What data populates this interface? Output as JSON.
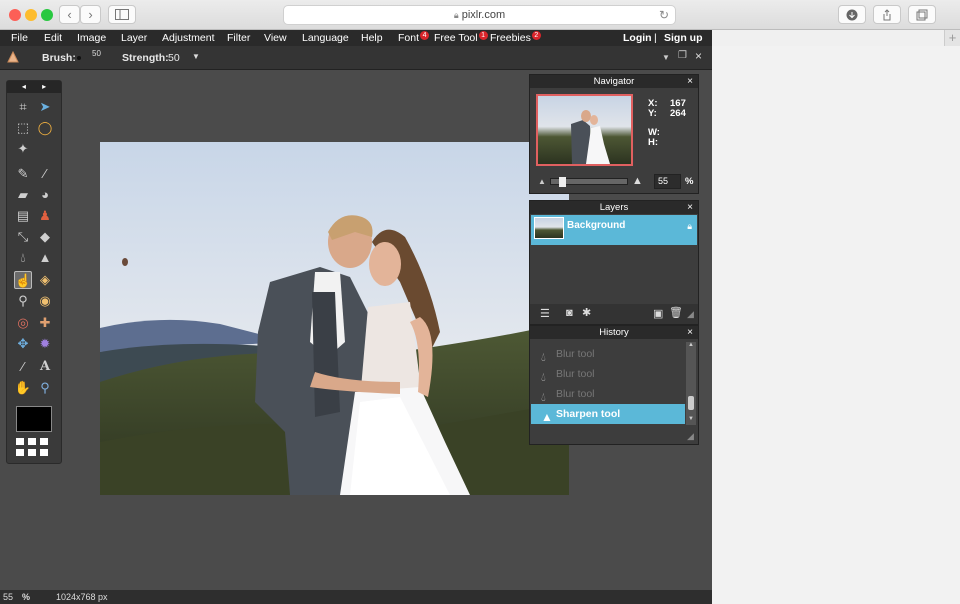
{
  "browser": {
    "url": "pixlr.com",
    "back": "‹",
    "forward": "›",
    "reload": "↻",
    "new_tab": "+"
  },
  "menu": {
    "file": "File",
    "edit": "Edit",
    "image": "Image",
    "layer": "Layer",
    "adjustment": "Adjustment",
    "filter": "Filter",
    "view": "View",
    "language": "Language",
    "help": "Help",
    "font": "Font",
    "font_badge": "4",
    "free_tool": "Free Tool",
    "free_tool_badge": "1",
    "freebies": "Freebies",
    "freebies_badge": "2",
    "login": "Login",
    "separator": "|",
    "signup": "Sign up"
  },
  "options": {
    "brush_label": "Brush:",
    "brush_size": "50",
    "strength_label": "Strength:",
    "strength_value": "50"
  },
  "tools": {
    "nav_left": "◂",
    "nav_right": "▸"
  },
  "navigator": {
    "title": "Navigator",
    "close": "×",
    "x_label": "X:",
    "x_value": "167",
    "y_label": "Y:",
    "y_value": "264",
    "w_label": "W:",
    "h_label": "H:",
    "zoom_value": "55",
    "zoom_unit": "%"
  },
  "layers": {
    "title": "Layers",
    "close": "×",
    "items": [
      {
        "label": "Background"
      }
    ]
  },
  "history": {
    "title": "History",
    "close": "×",
    "items": [
      {
        "label": "Blur tool"
      },
      {
        "label": "Blur tool"
      },
      {
        "label": "Blur tool"
      },
      {
        "label": "Sharpen tool"
      }
    ]
  },
  "status": {
    "zoom": "55",
    "zoom_unit": "%",
    "dimensions": "1024x768 px"
  },
  "colors": {
    "accent": "#5bb8d8",
    "badge": "#d9252b",
    "menubar": "#2a2a2a",
    "workspace": "#4b4b4b"
  }
}
